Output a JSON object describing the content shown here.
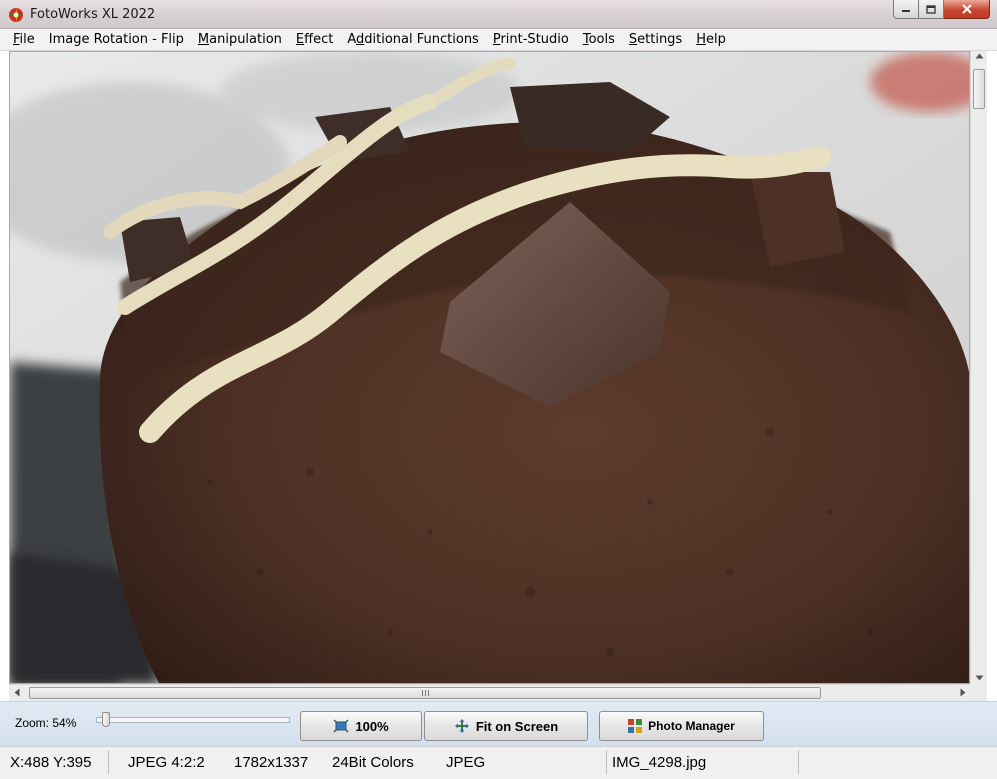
{
  "window": {
    "title": "FotoWorks XL 2022"
  },
  "menu": [
    {
      "pre": "",
      "u": "F",
      "post": "ile"
    },
    {
      "pre": "Image Rotation - Flip",
      "u": "",
      "post": ""
    },
    {
      "pre": "",
      "u": "M",
      "post": "anipulation"
    },
    {
      "pre": "",
      "u": "E",
      "post": "ffect"
    },
    {
      "pre": "A",
      "u": "d",
      "post": "ditional Functions"
    },
    {
      "pre": "",
      "u": "P",
      "post": "rint-Studio"
    },
    {
      "pre": "",
      "u": "T",
      "post": "ools"
    },
    {
      "pre": "",
      "u": "S",
      "post": "ettings"
    },
    {
      "pre": "",
      "u": "H",
      "post": "elp"
    }
  ],
  "image": {
    "subject": "chocolate muffin with chocolate chunks and white icing drizzle"
  },
  "toolbar": {
    "zoom_label": "Zoom: 54%",
    "zoom_percent": 54,
    "btn_100": "100%",
    "btn_fit": "Fit on Screen",
    "btn_photo_manager": "Photo Manager"
  },
  "status": {
    "coords": "X:488 Y:395",
    "format_subsampling": "JPEG  4:2:2",
    "dimensions": "1782x1337",
    "colors": "24Bit Colors",
    "format": "JPEG",
    "filename": "IMG_4298.jpg"
  },
  "colors": {
    "titlebar": "#d9d2d6",
    "toolbar": "#d4e0ee",
    "close_button": "#c7462f"
  }
}
